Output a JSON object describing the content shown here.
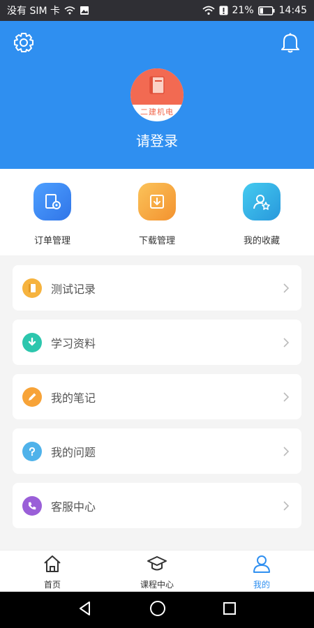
{
  "statusbar": {
    "carrier": "没有 SIM 卡",
    "battery": "21%",
    "time": "14:45"
  },
  "profile": {
    "avatar_caption": "二建机电",
    "login_label": "请登录"
  },
  "header_icons": {
    "settings": "gear-icon",
    "notifications": "bell-icon"
  },
  "quick_actions": [
    {
      "label": "订单管理",
      "icon": "order-settings-icon",
      "color": "#3d8ef5"
    },
    {
      "label": "下载管理",
      "icon": "download-icon",
      "color": "#f6a63c"
    },
    {
      "label": "我的收藏",
      "icon": "user-star-icon",
      "color": "#2fb0e4"
    }
  ],
  "menu": [
    {
      "label": "测试记录",
      "icon": "notebook-icon",
      "color": "#f6b33e"
    },
    {
      "label": "学习资料",
      "icon": "download-arrow-icon",
      "color": "#2cc6ad"
    },
    {
      "label": "我的笔记",
      "icon": "pencil-icon",
      "color": "#f7a338"
    },
    {
      "label": "我的问题",
      "icon": "question-icon",
      "color": "#4fb2ea"
    },
    {
      "label": "客服中心",
      "icon": "phone-icon",
      "color": "#9a5fd8"
    }
  ],
  "tabs": [
    {
      "label": "首页",
      "icon": "home-icon",
      "active": false
    },
    {
      "label": "课程中心",
      "icon": "graduation-cap-icon",
      "active": false
    },
    {
      "label": "我的",
      "icon": "user-icon",
      "active": true
    }
  ],
  "colors": {
    "primary": "#2f8ff0",
    "avatar_bg": "#f26a52"
  }
}
